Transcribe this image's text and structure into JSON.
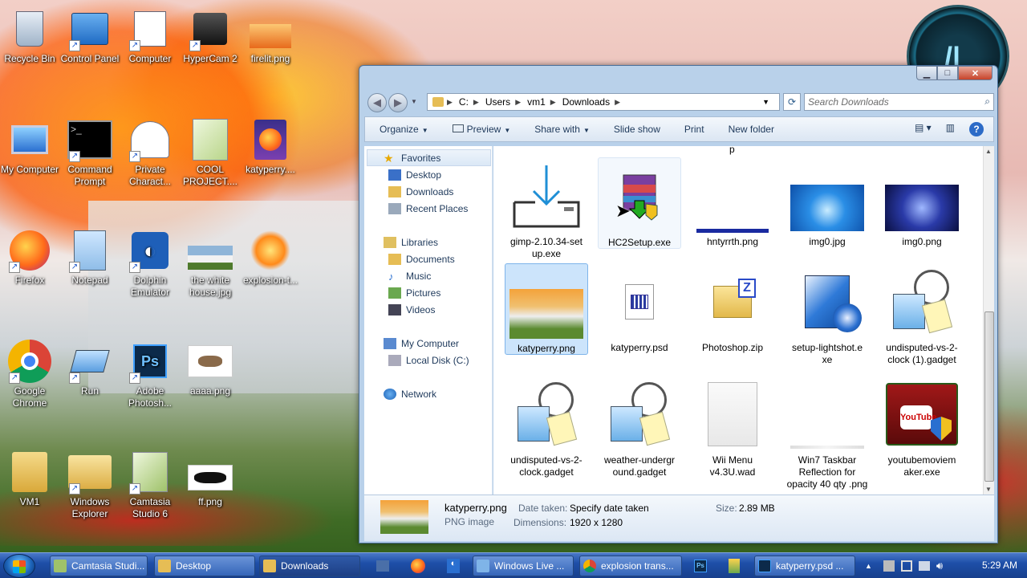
{
  "desktop": {
    "icons": [
      {
        "label": "Recycle Bin"
      },
      {
        "label": "Control Panel"
      },
      {
        "label": "Computer"
      },
      {
        "label": "HyperCam 2"
      },
      {
        "label": "firelit.png"
      },
      {
        "label": "My Computer"
      },
      {
        "label": "Command Prompt"
      },
      {
        "label": "Private Charact..."
      },
      {
        "label": "COOL PROJECT...."
      },
      {
        "label": "katyperry...."
      },
      {
        "label": "Firefox"
      },
      {
        "label": "Notepad"
      },
      {
        "label": "Dolphin Emulator"
      },
      {
        "label": "the white house.jpg"
      },
      {
        "label": "explosion-t..."
      },
      {
        "label": "Google Chrome"
      },
      {
        "label": "Run"
      },
      {
        "label": "Adobe Photosh..."
      },
      {
        "label": "aaaa.png"
      },
      {
        "label": "VM1"
      },
      {
        "label": "Windows Explorer"
      },
      {
        "label": "Camtasia Studio 6"
      },
      {
        "label": "ff.png"
      }
    ]
  },
  "window": {
    "caption": {
      "minimize": "▁",
      "maximize": "□",
      "close": "✕"
    },
    "address": {
      "segments": [
        "C:",
        "Users",
        "vm1",
        "Downloads"
      ],
      "search_placeholder": "Search Downloads"
    },
    "toolbar": {
      "organize": "Organize",
      "preview": "Preview",
      "share_with": "Share with",
      "slide_show": "Slide show",
      "print": "Print",
      "new_folder": "New folder"
    },
    "nav": {
      "favorites": "Favorites",
      "desktop": "Desktop",
      "downloads": "Downloads",
      "recent_places": "Recent Places",
      "libraries": "Libraries",
      "documents": "Documents",
      "music": "Music",
      "pictures": "Pictures",
      "videos": "Videos",
      "my_computer": "My Computer",
      "local_disk": "Local Disk (C:)",
      "network": "Network"
    },
    "partial_top_label": "p",
    "files": [
      {
        "name": "gimp-2.10.34-set up.exe"
      },
      {
        "name": "HC2Setup.exe"
      },
      {
        "name": "hntyrrth.png"
      },
      {
        "name": "img0.jpg"
      },
      {
        "name": "img0.png"
      },
      {
        "name": "katyperry.png"
      },
      {
        "name": "katyperry.psd"
      },
      {
        "name": "Photoshop.zip"
      },
      {
        "name": "setup-lightshot.e xe"
      },
      {
        "name": "undisputed-vs-2- clock (1).gadget"
      },
      {
        "name": "undisputed-vs-2- clock.gadget"
      },
      {
        "name": "weather-undergr ound.gadget"
      },
      {
        "name": "Wii Menu v4.3U.wad"
      },
      {
        "name": "Win7 Taskbar Reflection for opacity 40 qty .png"
      },
      {
        "name": "youtubemoviem aker.exe"
      }
    ],
    "details": {
      "filename": "katyperry.png",
      "type": "PNG image",
      "date_taken_label": "Date taken:",
      "date_taken_value": "Specify date taken",
      "dimensions_label": "Dimensions:",
      "dimensions_value": "1920 x 1280",
      "size_label": "Size:",
      "size_value": "2.89 MB"
    }
  },
  "taskbar": {
    "buttons": [
      {
        "label": "Camtasia Studi..."
      },
      {
        "label": "Desktop"
      },
      {
        "label": "Downloads"
      },
      {
        "label": "Windows Live ..."
      },
      {
        "label": "explosion trans..."
      },
      {
        "label": "katyperry.psd ..."
      }
    ],
    "clock": "5:29 AM"
  }
}
